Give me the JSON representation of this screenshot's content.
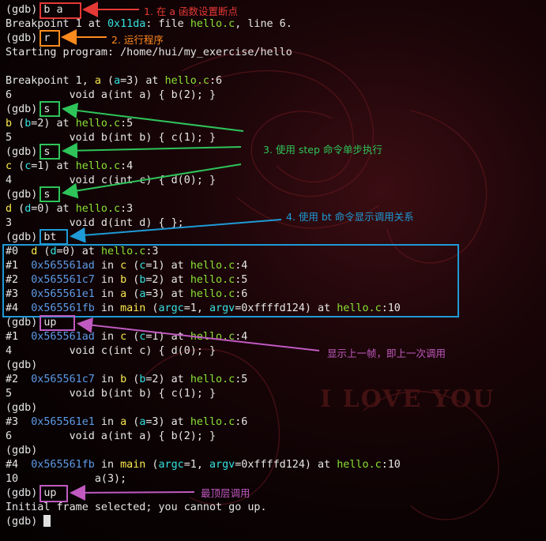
{
  "colors": {
    "background": "#0a0203",
    "text": "#e6e6e6",
    "file_green": "#8ae234",
    "address_cyan": "#34e2e2",
    "red_annotation": "#e53935",
    "orange_annotation": "#ff8a1e",
    "green_annotation": "#2ec45a",
    "blue_annotation": "#1e9ad6",
    "purple_annotation": "#c05ac0"
  },
  "wallpaper_text": "I LOVE YOU",
  "terminal": {
    "l1": {
      "prompt": "(gdb)",
      "cmd": "b a"
    },
    "l2": {
      "a": "Breakpoint 1 at ",
      "addr": "0x11da",
      "b": ": file ",
      "file": "hello.c",
      "c": ", line 6."
    },
    "l3": {
      "prompt": "(gdb)",
      "cmd": "r"
    },
    "l4": "Starting program: /home/hui/my_exercise/hello",
    "l6": {
      "a": "Breakpoint 1, ",
      "fn": "a",
      "b": " (",
      "var": "a",
      "c": "=3) at ",
      "file": "hello.c",
      "d": ":6"
    },
    "l7": "6         void a(int a) { b(2); }",
    "l8": {
      "prompt": "(gdb)",
      "cmd": "s"
    },
    "l9": {
      "fn": "b",
      "a": " (",
      "var": "b",
      "b": "=2) at ",
      "file": "hello.c",
      "c": ":5"
    },
    "l10": "5         void b(int b) { c(1); }",
    "l11": {
      "prompt": "(gdb)",
      "cmd": "s"
    },
    "l12": {
      "fn": "c",
      "a": " (",
      "var": "c",
      "b": "=1) at ",
      "file": "hello.c",
      "c": ":4"
    },
    "l13": "4         void c(int c) { d(0); }",
    "l14": {
      "prompt": "(gdb)",
      "cmd": "s"
    },
    "l15": {
      "fn": "d",
      "a": " (",
      "var": "d",
      "b": "=0) at ",
      "file": "hello.c",
      "c": ":3"
    },
    "l16": "3         void d(int d) { };",
    "l17": {
      "prompt": "(gdb)",
      "cmd": "bt"
    },
    "bt": [
      {
        "num": "#0  ",
        "addr": "",
        "in": "",
        "fn": "d",
        "a": " (",
        "var": "d",
        "b": "=0) at ",
        "file": "hello.c",
        "c": ":3"
      },
      {
        "num": "#1  ",
        "addr": "0x565561ad",
        "in": " in ",
        "fn": "c",
        "a": " (",
        "var": "c",
        "b": "=1) at ",
        "file": "hello.c",
        "c": ":4"
      },
      {
        "num": "#2  ",
        "addr": "0x565561c7",
        "in": " in ",
        "fn": "b",
        "a": " (",
        "var": "b",
        "b": "=2) at ",
        "file": "hello.c",
        "c": ":5"
      },
      {
        "num": "#3  ",
        "addr": "0x565561e1",
        "in": " in ",
        "fn": "a",
        "a": " (",
        "var": "a",
        "b": "=3) at ",
        "file": "hello.c",
        "c": ":6"
      }
    ],
    "bt4": {
      "num": "#4  ",
      "addr": "0x565561fb",
      "in": " in ",
      "fn": "main",
      "a": " (",
      "v1": "argc",
      "b": "=1, ",
      "v2": "argv",
      "c": "=0xffffd124) at ",
      "file": "hello.c",
      "d": ":10"
    },
    "l23": {
      "prompt": "(gdb)",
      "cmd": "up"
    },
    "l24": {
      "num": "#1  ",
      "addr": "0x565561ad",
      "in": " in ",
      "fn": "c",
      "a": " (",
      "var": "c",
      "b": "=1) at ",
      "file": "hello.c",
      "c": ":4"
    },
    "l25": "4         void c(int c) { d(0); }",
    "l26": "(gdb)",
    "l27": {
      "num": "#2  ",
      "addr": "0x565561c7",
      "in": " in ",
      "fn": "b",
      "a": " (",
      "var": "b",
      "b": "=2) at ",
      "file": "hello.c",
      "c": ":5"
    },
    "l28": "5         void b(int b) { c(1); }",
    "l29": "(gdb)",
    "l30": {
      "num": "#3  ",
      "addr": "0x565561e1",
      "in": " in ",
      "fn": "a",
      "a": " (",
      "var": "a",
      "b": "=3) at ",
      "file": "hello.c",
      "c": ":6"
    },
    "l31": "6         void a(int a) { b(2); }",
    "l32": "(gdb)",
    "l33": {
      "num": "#4  ",
      "addr": "0x565561fb",
      "in": " in ",
      "fn": "main",
      "a": " (",
      "v1": "argc",
      "b": "=1, ",
      "v2": "argv",
      "c": "=0xffffd124) at ",
      "file": "hello.c",
      "d": ":10"
    },
    "l34": "10            a(3);",
    "l35": {
      "prompt": "(gdb)",
      "cmd": "up"
    },
    "l36": "Initial frame selected; you cannot go up.",
    "l37": {
      "prompt": "(gdb) "
    }
  },
  "annotations": {
    "a1": "1. 在 a 函数设置断点",
    "a2": "2. 运行程序",
    "a3": "3. 使用 step 命令单步执行",
    "a4": "4. 使用 bt 命令显示调用关系",
    "a5": "显示上一帧，即上一次调用",
    "a6": "最顶层调用"
  }
}
